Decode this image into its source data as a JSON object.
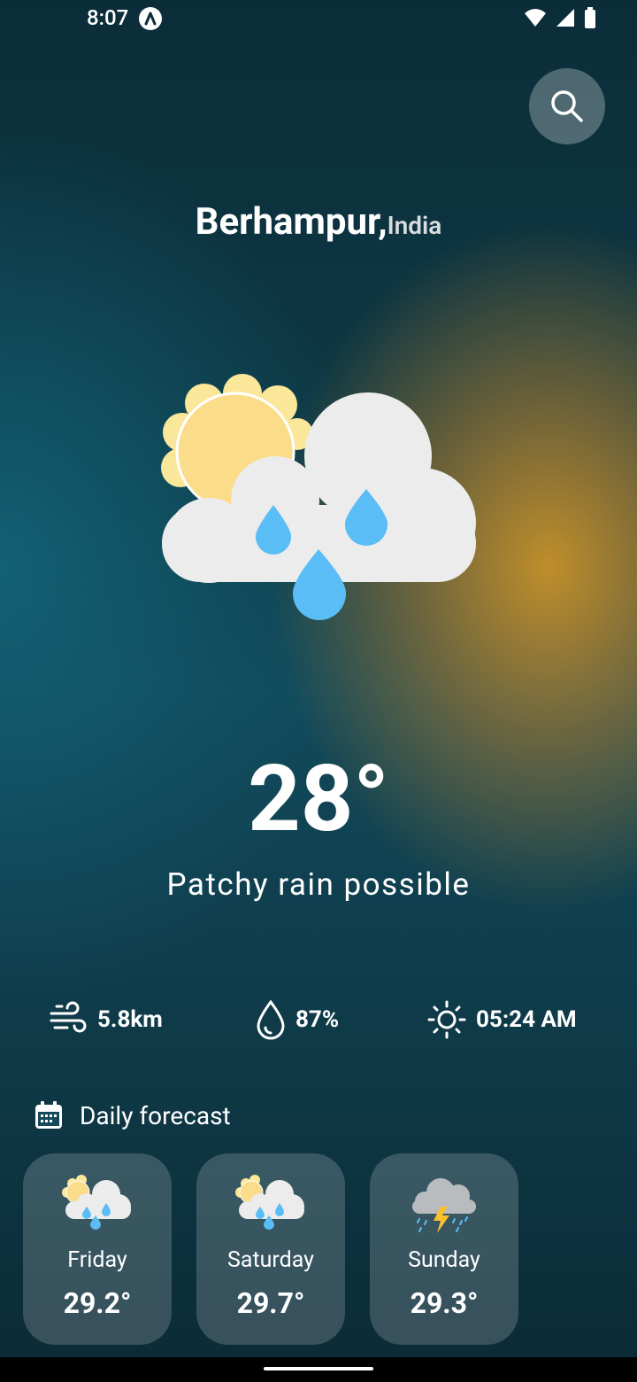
{
  "status": {
    "time": "8:07"
  },
  "location": {
    "city": "Berhampur,",
    "country": "India"
  },
  "current": {
    "temperature": "28°",
    "condition": "Patchy rain possible"
  },
  "stats": {
    "wind": "5.8km",
    "humidity": "87%",
    "sunrise": "05:24 AM"
  },
  "daily": {
    "heading": "Daily forecast",
    "days": [
      {
        "day": "Friday",
        "temp": "29.2°",
        "icon": "sun-cloud-rain-icon"
      },
      {
        "day": "Saturday",
        "temp": "29.7°",
        "icon": "sun-cloud-rain-icon"
      },
      {
        "day": "Sunday",
        "temp": "29.3°",
        "icon": "thunder-rain-icon"
      }
    ]
  },
  "colors": {
    "rain_drop": "#5bbdf5",
    "sun": "#fbdc8a",
    "cloud": "#ececec"
  }
}
